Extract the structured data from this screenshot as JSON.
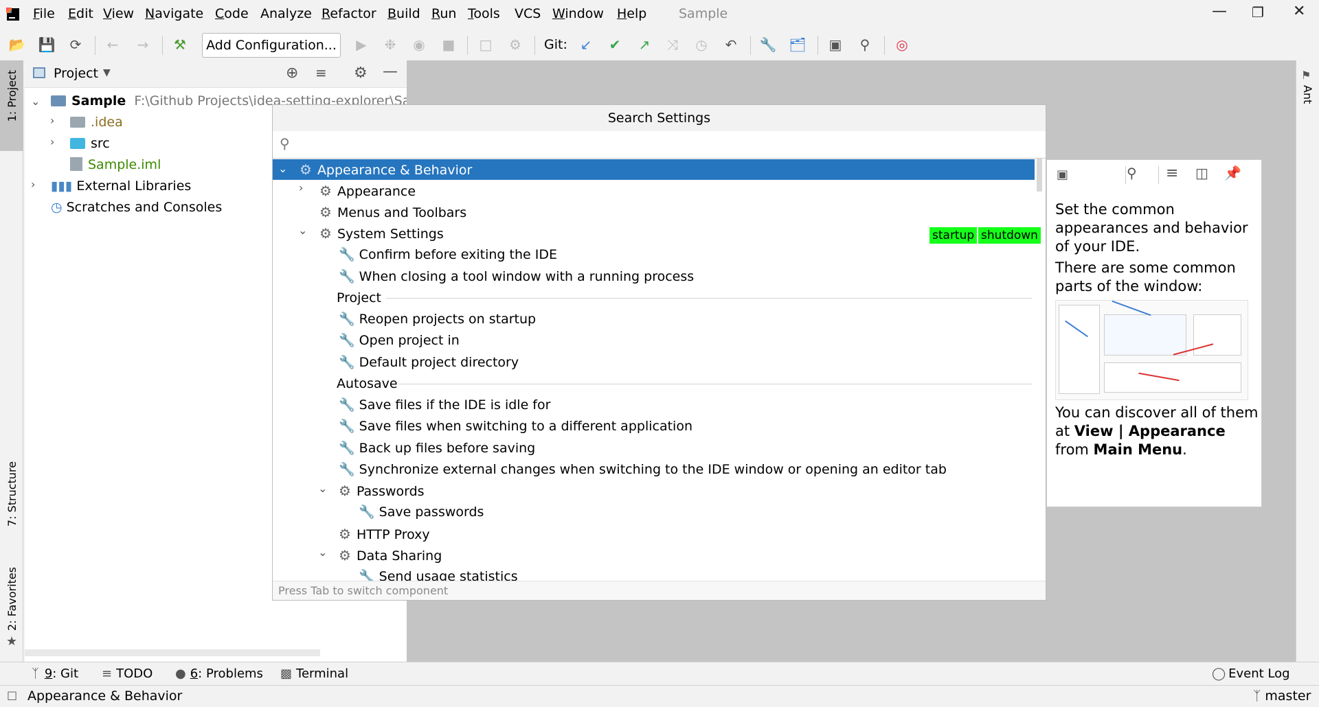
{
  "app": {
    "project_title": "Sample"
  },
  "menu": [
    {
      "u": "F",
      "rest": "ile"
    },
    {
      "u": "E",
      "rest": "dit"
    },
    {
      "u": "V",
      "rest": "iew"
    },
    {
      "u": "N",
      "rest": "avigate"
    },
    {
      "u": "C",
      "rest": "ode"
    },
    {
      "u": "",
      "rest": "Analyze"
    },
    {
      "u": "R",
      "rest": "efactor"
    },
    {
      "u": "B",
      "rest": "uild"
    },
    {
      "u": "R",
      "rest": "un"
    },
    {
      "u": "T",
      "rest": "ools"
    },
    {
      "u": "",
      "rest": "VCS"
    },
    {
      "u": "W",
      "rest": "indow"
    },
    {
      "u": "H",
      "rest": "elp"
    }
  ],
  "toolbar": {
    "add_configuration": "Add Configuration...",
    "git_label": "Git:"
  },
  "project_panel": {
    "title": "Project",
    "tree": {
      "root_name": "Sample",
      "root_path": "F:\\Github Projects\\idea-setting-explorer\\Sandbo",
      "idea": ".idea",
      "src": "src",
      "iml": "Sample.iml",
      "ext_libs": "External Libraries",
      "scratches": "Scratches and Consoles"
    }
  },
  "side_tabs": {
    "project": "1: Project",
    "structure": "7: Structure",
    "favorites": "2: Favorites",
    "ant": "Ant"
  },
  "popup": {
    "title": "Search Settings",
    "search_value": "",
    "items": {
      "appearance_behavior": "Appearance & Behavior",
      "appearance": "Appearance",
      "menus_toolbars": "Menus and Toolbars",
      "system_settings": "System Settings",
      "confirm_exit": "Confirm before exiting the IDE",
      "closing_tool_window": "When closing a tool window with a running process",
      "project_section": "Project",
      "reopen_projects": "Reopen projects on startup",
      "open_project_in": "Open project in",
      "default_project_dir": "Default project directory",
      "autosave_section": "Autosave",
      "save_idle": "Save files if the IDE is idle for",
      "save_switching": "Save files when switching to a different application",
      "backup_files": "Back up files before saving",
      "sync_external": "Synchronize external changes when switching to the IDE window or opening an editor tab",
      "passwords": "Passwords",
      "save_passwords": "Save passwords",
      "http_proxy": "HTTP Proxy",
      "data_sharing": "Data Sharing",
      "send_usage": "Send usage statistics"
    },
    "tags": {
      "startup": "startup",
      "shutdown": "shutdown"
    },
    "status": "Press Tab to switch component"
  },
  "doc": {
    "p1": "Set the common appearances and behavior of your IDE.",
    "p2": "There are some common parts of the window:",
    "p3_a": "You can discover all of them at ",
    "p3_b": "View | Appearance",
    "p3_c": " from ",
    "p3_d": "Main Menu",
    "p3_e": "."
  },
  "bottom_tools": {
    "git_num": "9",
    "git": ": Git",
    "todo": "TODO",
    "problems_num": "6",
    "problems": ": Problems",
    "terminal": "Terminal",
    "event_log": "Event Log"
  },
  "status_bar": {
    "text": "Appearance & Behavior",
    "branch": "master"
  },
  "colors": {
    "selection": "#2675bf",
    "tag_bg": "#15ff1a",
    "editor_bg": "#c4c4c4"
  }
}
